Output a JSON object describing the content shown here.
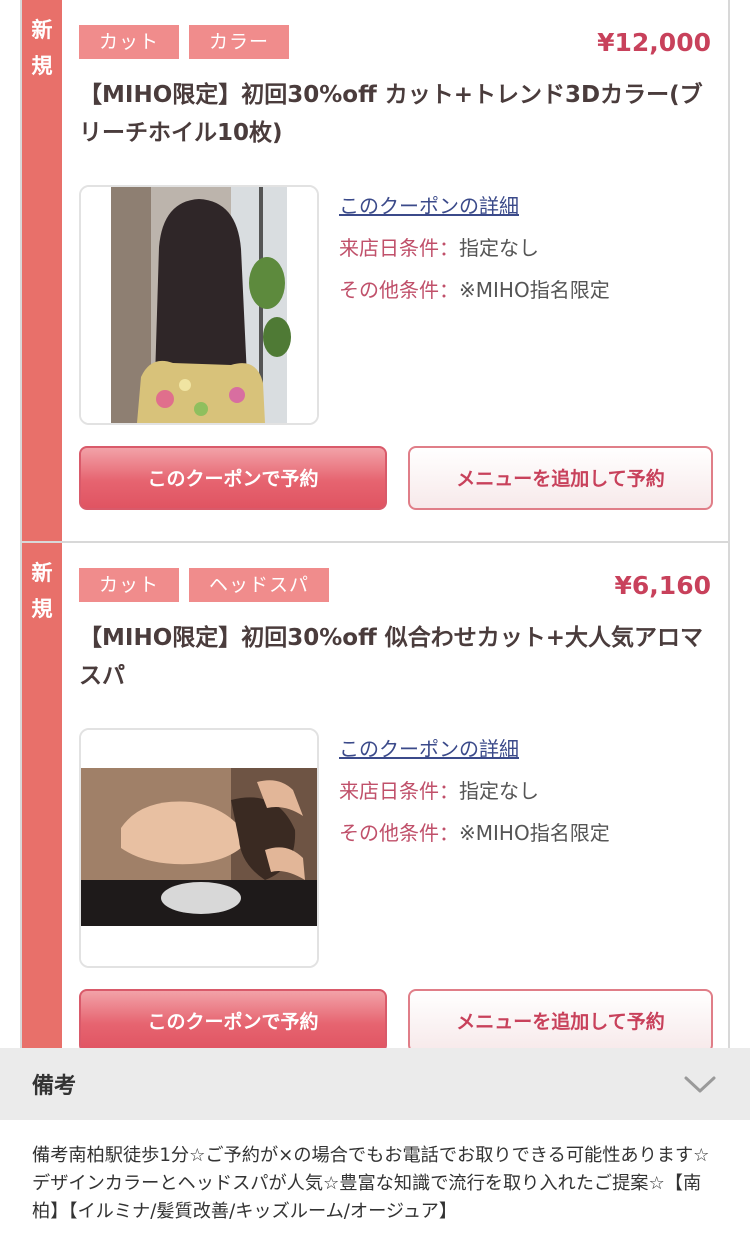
{
  "coupons": [
    {
      "new_badge": [
        "新",
        "規"
      ],
      "tags": [
        "カット",
        "カラー"
      ],
      "price": "¥12,000",
      "title": "【MIHO限定】初回30%off カット+トレンド3Dカラー(ブリーチホイル10枚)",
      "detail_link": "このクーポンの詳細",
      "visit_label": "来店日条件：",
      "visit_value": "指定なし",
      "other_label": "その他条件：",
      "other_value": "※MIHO指名限定",
      "book_button": "このクーポンで予約",
      "add_menu_button": "メニューを追加して予約"
    },
    {
      "new_badge": [
        "新",
        "規"
      ],
      "tags": [
        "カット",
        "ヘッドスパ"
      ],
      "price": "¥6,160",
      "title": "【MIHO限定】初回30%off 似合わせカット+大人気アロマスパ",
      "detail_link": "このクーポンの詳細",
      "visit_label": "来店日条件：",
      "visit_value": "指定なし",
      "other_label": "その他条件：",
      "other_value": "※MIHO指名限定",
      "book_button": "このクーポンで予約",
      "add_menu_button": "メニューを追加して予約"
    }
  ],
  "remarks": {
    "title": "備考",
    "icon": "chevron-down-icon",
    "text": "備考南柏駅徒歩1分☆ご予約が×の場合でもお電話でお取りできる可能性あります☆デザインカラーとヘッドスパが人気☆豊富な知識で流行を取り入れたご提案☆【南柏】【イルミナ/髪質改善/キッズルーム/オージュア】"
  },
  "colors": {
    "new_strip": "#e8706a",
    "tag_bg": "#f08c8c",
    "price": "#c8415b",
    "link": "#3b4a8a",
    "condition_label": "#c0506a"
  }
}
